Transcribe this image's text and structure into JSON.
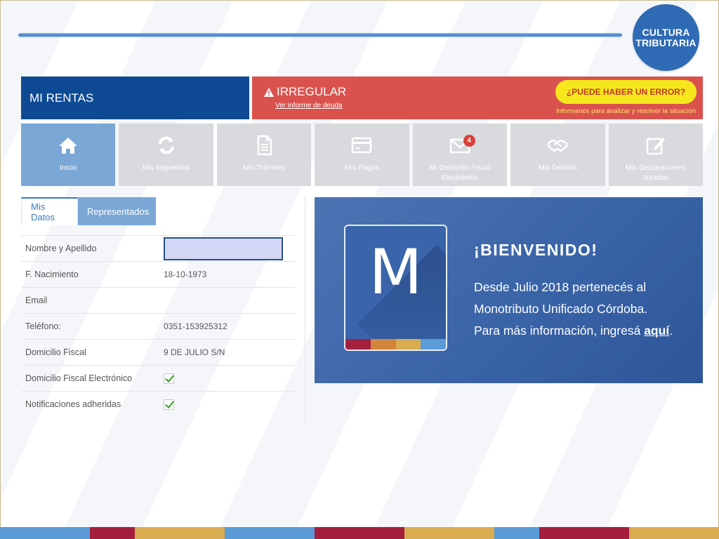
{
  "logo": {
    "line1": "CULTURA",
    "line2": "TRIBUTARIA"
  },
  "header": {
    "title": "MI RENTAS",
    "status_label": "IRREGULAR",
    "status_link": "Ver informe de deuda",
    "error_button": "¿PUEDE HABER UN ERROR?",
    "error_sub": "Informanos para analizar y resolver la situación"
  },
  "tiles": [
    {
      "label": "Inicio",
      "icon": "home-icon",
      "active": true
    },
    {
      "label": "Mis Impuestos",
      "icon": "refresh-icon",
      "active": false
    },
    {
      "label": "Mis Trámites",
      "icon": "document-icon",
      "active": false
    },
    {
      "label": "Mis Pagos",
      "icon": "card-icon",
      "active": false
    },
    {
      "label": "Mi Domicilio Fiscal Electrónico",
      "icon": "mail-icon",
      "active": false,
      "badge": "4"
    },
    {
      "label": "Mis Débitos",
      "icon": "handshake-icon",
      "active": false
    },
    {
      "label": "Mis Declaraciones Juradas",
      "icon": "edit-icon",
      "active": false
    }
  ],
  "tabs": {
    "mis_datos": "Mis Datos",
    "representados": "Representados"
  },
  "datos": {
    "nombre_label": "Nombre y Apellido",
    "nacimiento_label": "F. Nacimiento",
    "nacimiento_value": "18-10-1973",
    "email_label": "Email",
    "email_value": "",
    "telefono_label": "Teléfono:",
    "telefono_value": "0351-153925312",
    "domicilio_label": "Domicilio Fiscal",
    "domicilio_value": "9 DE JULIO S/N",
    "dfe_label": "Domicilio Fiscal Electrónico",
    "dfe_checked": true,
    "notif_label": "Notificaciones adheridas",
    "notif_checked": true
  },
  "banner": {
    "logo_letter": "M",
    "title": "¡BIENVENIDO!",
    "line1": "Desde Julio 2018 pertenecés al",
    "line2": "Monotributo Unificado Córdoba.",
    "line3_prefix": "Para más información, ingresá ",
    "line3_link": "aquí",
    "line3_suffix": "."
  },
  "colors": {
    "primary_blue": "#0e4a94",
    "status_red": "#d9524e",
    "error_yellow": "#f6e71c",
    "tile_active": "#7aa7d6",
    "tile_inactive": "#d8dade",
    "stripe_colors": [
      "#a31f3d",
      "#d2843c",
      "#d9ac52",
      "#5a9bd8"
    ]
  }
}
